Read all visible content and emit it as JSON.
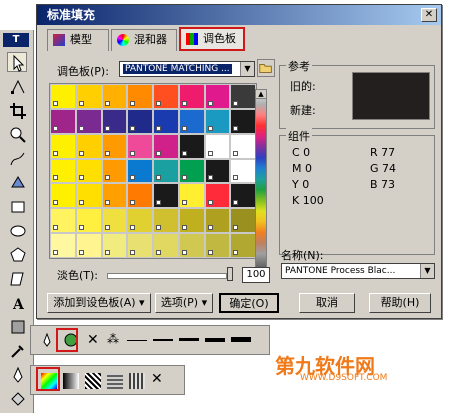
{
  "dialog": {
    "title": "标准填充",
    "close": "✕",
    "tabs": [
      {
        "label": "模型"
      },
      {
        "label": "混和器"
      },
      {
        "label": "调色板"
      }
    ]
  },
  "palette_pane": {
    "palette_label": "调色板(P):",
    "palette_value": "PANTONE MATCHING ...",
    "tint_label": "淡色(T):",
    "tint_value": "100",
    "grid_colors": [
      "#ffef00",
      "#ffcf00",
      "#ffb000",
      "#ff8a00",
      "#ff4e20",
      "#ef1c6e",
      "#e01a8c",
      "#3a3a3a",
      "#a0258a",
      "#7a2a90",
      "#3a2a8a",
      "#202a8a",
      "#1a3ab0",
      "#1a6ad0",
      "#1a9ac0",
      "#1a1a1a",
      "#ffef00",
      "#ffcf00",
      "#ff9a00",
      "#ef4a9a",
      "#d0208a",
      "#1a1a1a",
      "#ffffff",
      "#ffffff",
      "#ffef00",
      "#ffdf00",
      "#ff9a00",
      "#0a7ad0",
      "#1aa0a0",
      "#00a050",
      "#1a1a1a",
      "#ffffff",
      "#fff000",
      "#ffdf00",
      "#ffa000",
      "#ff7a00",
      "#1a1a1a",
      "#ffef30",
      "#ff2a3a",
      "#1a1a1a",
      "#fff460",
      "#fff040",
      "#efe040",
      "#e0d030",
      "#d0c030",
      "#c0b020",
      "#b0a020",
      "#9a9020",
      "#fff8a0",
      "#fff490",
      "#f0ec80",
      "#e8e070",
      "#e0d860",
      "#d0c850",
      "#c0b840",
      "#b0a830"
    ]
  },
  "reference": {
    "title": "参考",
    "old_label": "旧的:",
    "new_label": "新建:"
  },
  "components": {
    "title": "组件",
    "c": "C  0",
    "m": "M  0",
    "y": "Y  0",
    "k": "K 100",
    "r": "R   77",
    "g": "G   74",
    "b": "B   73",
    "name_label": "名称(N):",
    "name_value": "PANTONE Process Blac..."
  },
  "buttons": {
    "add_to_palette": "添加到设色板(A)",
    "options": "选项(P)",
    "ok": "确定(O)",
    "cancel": "取消",
    "help": "帮助(H)"
  },
  "toolbox": {
    "top_label": "T"
  },
  "watermark": {
    "logo": "第九软件网",
    "url": "WWW.D9SOFT.COM"
  },
  "colors": {
    "highlight": "#d01818",
    "ref_swatch": "#231f1e"
  }
}
